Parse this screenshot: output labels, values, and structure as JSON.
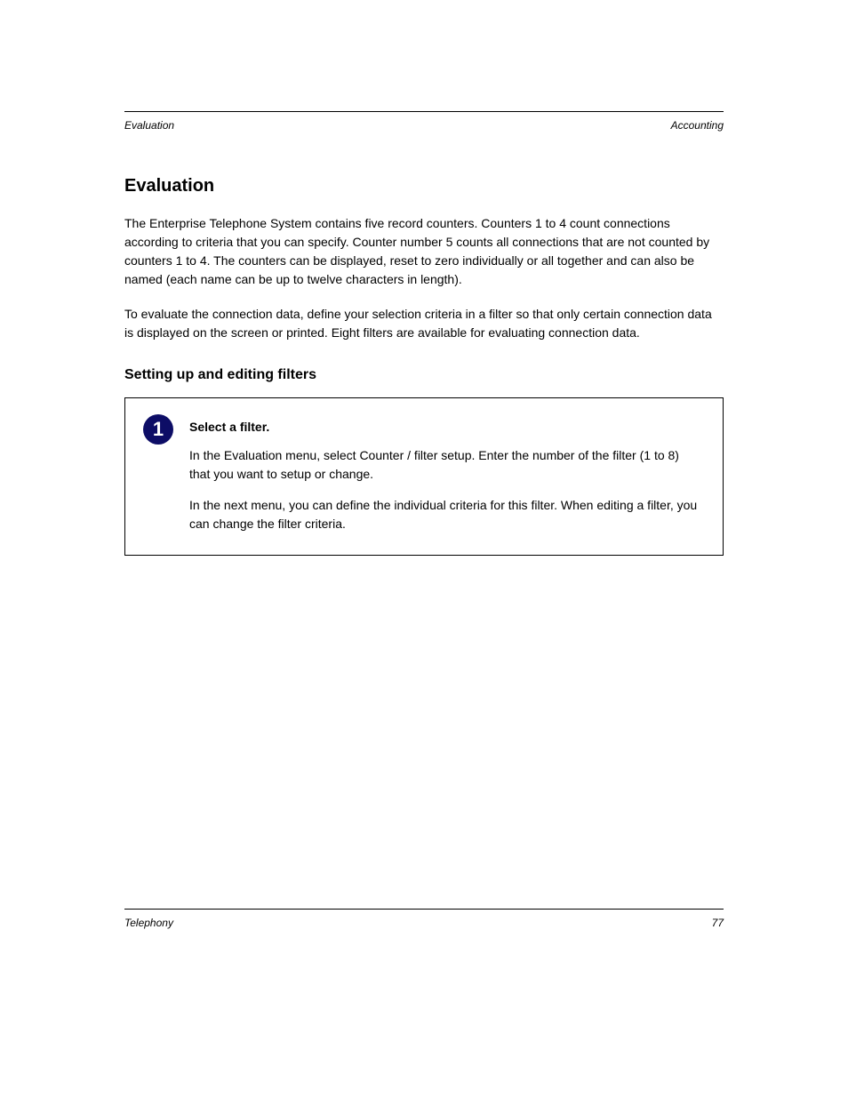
{
  "header": {
    "left": "Evaluation",
    "right": "Accounting"
  },
  "heading2": "Evaluation",
  "para1": "The Enterprise Telephone System contains five record counters. Counters 1 to 4 count connections according to criteria that you can specify. Counter number 5 counts all connections that are not counted by counters 1 to 4. The counters can be displayed, reset to zero individually or all together and can also be named (each name can be up to twelve characters in length).",
  "para2": "To evaluate the connection data, define your selection criteria in a filter so that only certain connection data is displayed on the screen or printed. Eight filters are available for evaluating connection data.",
  "heading3": "Setting up and editing filters",
  "step": {
    "number": "1",
    "title": "Select a filter.",
    "p1": "In the Evaluation menu, select Counter / filter setup. Enter the number of the filter (1 to 8) that you want to setup or change.",
    "p2": "In the next menu, you can define the individual criteria for this filter. When editing a filter, you can change the filter criteria."
  },
  "footer": {
    "left": "Telephony",
    "right": "77"
  }
}
